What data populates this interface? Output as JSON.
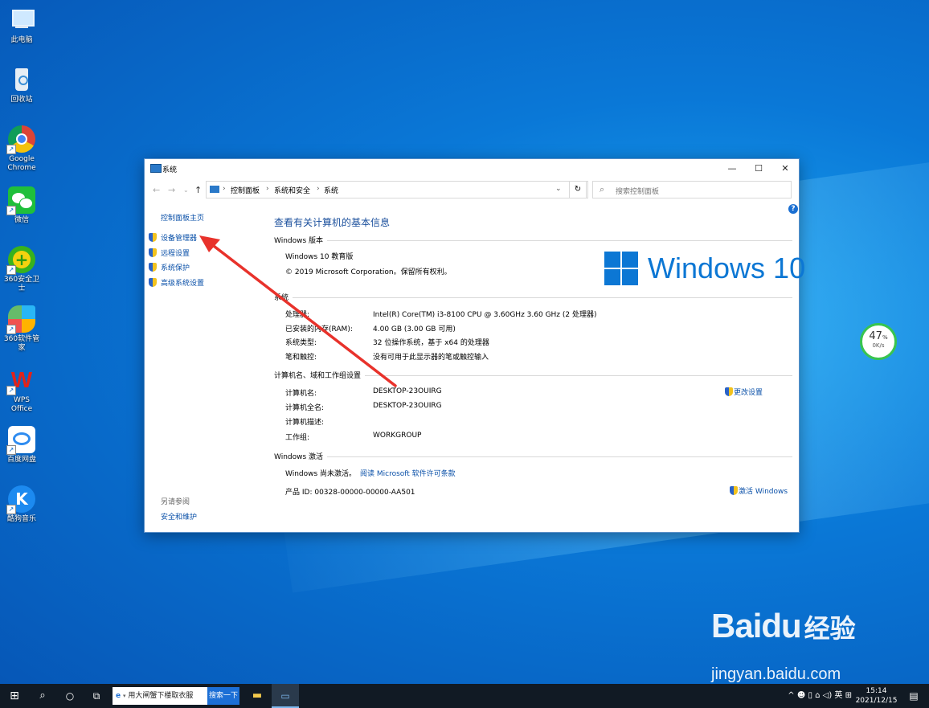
{
  "desktop": {
    "icons": [
      {
        "label": "此电脑"
      },
      {
        "label": "回收站"
      },
      {
        "label": "Google Chrome"
      },
      {
        "label": "微信"
      },
      {
        "label": "360安全卫士"
      },
      {
        "label": "360软件管家"
      },
      {
        "label": "WPS Office"
      },
      {
        "label": "百度网盘"
      },
      {
        "label": "酷狗音乐"
      }
    ],
    "gauge": {
      "percent": "47",
      "unit": "%",
      "speed": "0K/s"
    },
    "watermark": {
      "brand": "Bai",
      "brand_suffix": "经验",
      "url": "jingyan.baidu.com"
    }
  },
  "window": {
    "title": "系统",
    "controls": {
      "minimize": "—",
      "maximize": "☐",
      "close": "✕"
    },
    "address": {
      "crumbs": [
        "控制面板",
        "系统和安全",
        "系统"
      ],
      "separator": "›"
    },
    "search": {
      "placeholder": "搜索控制面板"
    },
    "sidebar": {
      "home": "控制面板主页",
      "links": [
        "设备管理器",
        "远程设置",
        "系统保护",
        "高级系统设置"
      ],
      "see_also_title": "另请参阅",
      "see_also_links": [
        "安全和维护"
      ]
    },
    "main": {
      "heading": "查看有关计算机的基本信息",
      "edition_section": "Windows 版本",
      "edition": "Windows 10 教育版",
      "copyright": "© 2019 Microsoft Corporation。保留所有权利。",
      "logo_text": "Windows 10",
      "system_section": "系统",
      "system_rows": [
        {
          "label": "处理器:",
          "value": "Intel(R) Core(TM) i3-8100 CPU @ 3.60GHz   3.60 GHz  (2 处理器)"
        },
        {
          "label": "已安装的内存(RAM):",
          "value": "4.00 GB (3.00 GB 可用)"
        },
        {
          "label": "系统类型:",
          "value": "32 位操作系统，基于 x64 的处理器"
        },
        {
          "label": "笔和触控:",
          "value": "没有可用于此显示器的笔或触控输入"
        }
      ],
      "computer_section": "计算机名、域和工作组设置",
      "computer_rows": [
        {
          "label": "计算机名:",
          "value": "DESKTOP-23OUIRG"
        },
        {
          "label": "计算机全名:",
          "value": "DESKTOP-23OUIRG"
        },
        {
          "label": "计算机描述:",
          "value": ""
        },
        {
          "label": "工作组:",
          "value": "WORKGROUP"
        }
      ],
      "change_settings": "更改设置",
      "activation_section": "Windows 激活",
      "activation_status": "Windows 尚未激活。",
      "license_link": "阅读 Microsoft 软件许可条款",
      "product_id": "产品 ID: 00328-00000-00000-AA501",
      "activate_link": "激活 Windows"
    }
  },
  "taskbar": {
    "search_text": "用大闸蟹下楼取衣服",
    "search_button": "搜索一下",
    "tray_text": "^ ☻ ▯ ⌂ ◁) 英 ⊞",
    "time": "15:14",
    "date": "2021/12/15"
  },
  "colors": {
    "accent": "#0c77d4",
    "link": "#0a50a8",
    "arrow": "#e8322b"
  }
}
